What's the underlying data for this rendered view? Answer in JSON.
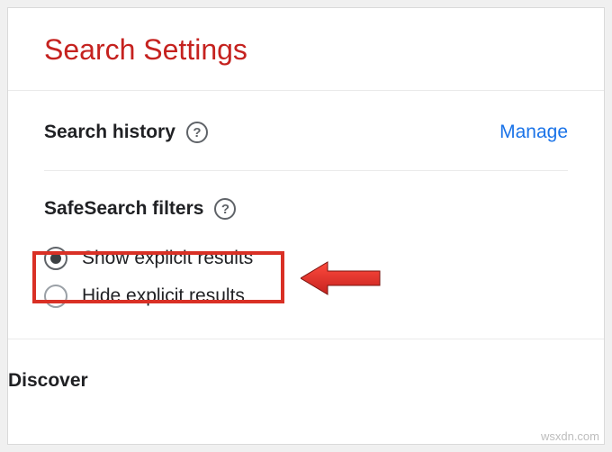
{
  "title": "Search Settings",
  "searchHistory": {
    "label": "Search history",
    "manage": "Manage"
  },
  "safeSearch": {
    "label": "SafeSearch filters",
    "options": {
      "show": "Show explicit results",
      "hide": "Hide explicit results"
    }
  },
  "discover": {
    "label": "Discover"
  },
  "watermark": "wsxdn.com"
}
